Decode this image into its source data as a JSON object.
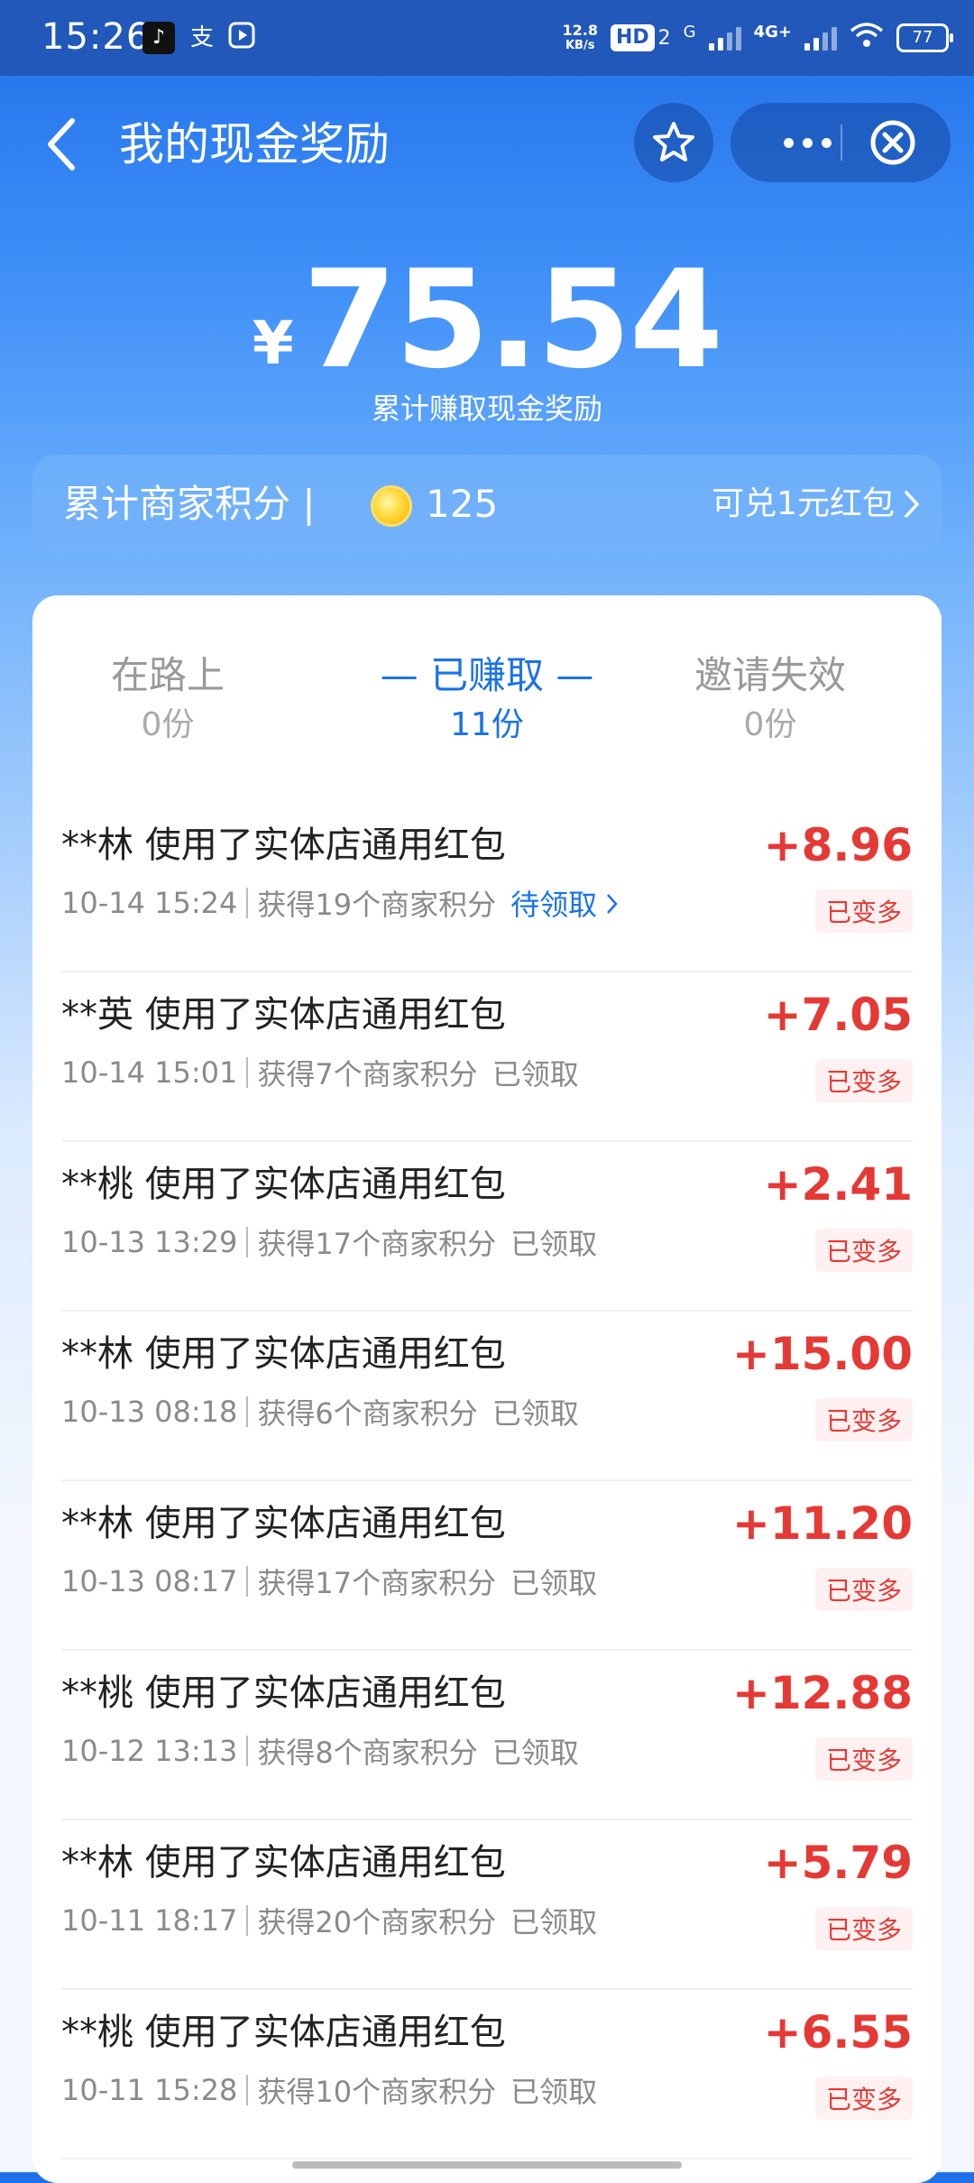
{
  "status_bar": {
    "time": "15:26",
    "net_speed": "12.8",
    "net_unit": "KB/s",
    "hd": "HD",
    "sub2": "2",
    "g": "G",
    "fourg": "4G+",
    "battery": "77"
  },
  "header": {
    "title": "我的现金奖励",
    "icons": [
      "back-icon",
      "star-icon",
      "more-icon",
      "close-icon"
    ]
  },
  "summary": {
    "currency": "¥",
    "amount": "75.54",
    "label": "累计赚取现金奖励"
  },
  "points": {
    "label": "累计商家积分 |",
    "value": "125",
    "exchange": "可兑1元红包"
  },
  "tabs": [
    {
      "label": "在路上",
      "count": "0份",
      "active": false
    },
    {
      "label": "已赚取",
      "count": "11份",
      "active": true
    },
    {
      "label": "邀请失效",
      "count": "0份",
      "active": false
    }
  ],
  "records": [
    {
      "title": "**林 使用了实体店通用红包",
      "time": "10-14 15:24",
      "points": "获得19个商家积分",
      "status": "待领取",
      "status_link": true,
      "amount": "+8.96",
      "tag": "已变多"
    },
    {
      "title": "**英 使用了实体店通用红包",
      "time": "10-14 15:01",
      "points": "获得7个商家积分",
      "status": "已领取",
      "status_link": false,
      "amount": "+7.05",
      "tag": "已变多"
    },
    {
      "title": "**桃 使用了实体店通用红包",
      "time": "10-13 13:29",
      "points": "获得17个商家积分",
      "status": "已领取",
      "status_link": false,
      "amount": "+2.41",
      "tag": "已变多"
    },
    {
      "title": "**林 使用了实体店通用红包",
      "time": "10-13 08:18",
      "points": "获得6个商家积分",
      "status": "已领取",
      "status_link": false,
      "amount": "+15.00",
      "tag": "已变多"
    },
    {
      "title": "**林 使用了实体店通用红包",
      "time": "10-13 08:17",
      "points": "获得17个商家积分",
      "status": "已领取",
      "status_link": false,
      "amount": "+11.20",
      "tag": "已变多"
    },
    {
      "title": "**桃 使用了实体店通用红包",
      "time": "10-12 13:13",
      "points": "获得8个商家积分",
      "status": "已领取",
      "status_link": false,
      "amount": "+12.88",
      "tag": "已变多"
    },
    {
      "title": "**林 使用了实体店通用红包",
      "time": "10-11 18:17",
      "points": "获得20个商家积分",
      "status": "已领取",
      "status_link": false,
      "amount": "+5.79",
      "tag": "已变多"
    },
    {
      "title": "**桃 使用了实体店通用红包",
      "time": "10-11 15:28",
      "points": "获得10个商家积分",
      "status": "已领取",
      "status_link": false,
      "amount": "+6.55",
      "tag": "已变多"
    }
  ],
  "colors": {
    "accent": "#1a73e8",
    "amount_red": "#e53935",
    "header_blue": "#2158b9"
  }
}
